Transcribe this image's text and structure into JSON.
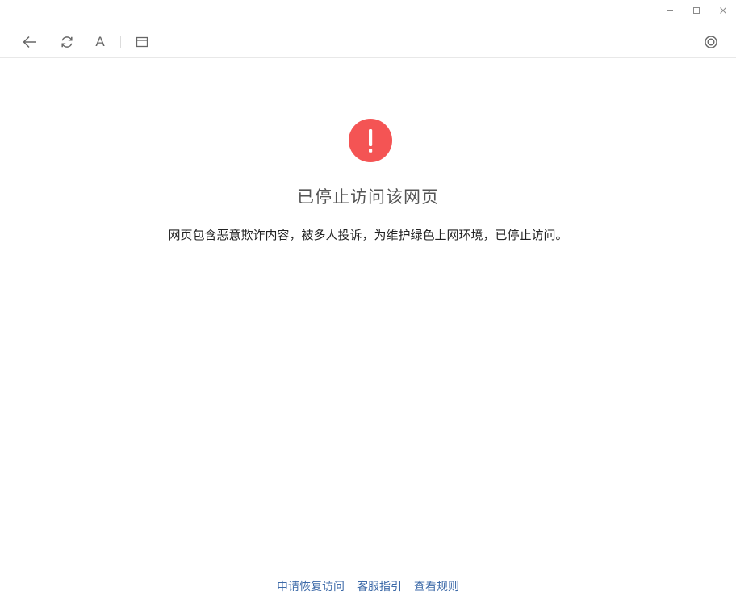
{
  "window_controls": {
    "minimize_icon": "minimize-icon",
    "maximize_icon": "maximize-icon",
    "close_icon": "close-icon"
  },
  "toolbar": {
    "back_icon": "arrow-left-icon",
    "refresh_icon": "refresh-icon",
    "font_label": "A",
    "reader_icon": "window-icon",
    "settings_icon": "target-ring-icon"
  },
  "blocked_page": {
    "icon": "exclamation-circle-icon",
    "icon_color": "#f45454",
    "title": "已停止访问该网页",
    "description": "网页包含恶意欺诈内容，被多人投诉，为维护绿色上网环境，已停止访问。"
  },
  "footer": {
    "links": [
      {
        "label": "申请恢复访问"
      },
      {
        "label": "客服指引"
      },
      {
        "label": "查看规则"
      }
    ],
    "link_color": "#3d6aa8"
  }
}
